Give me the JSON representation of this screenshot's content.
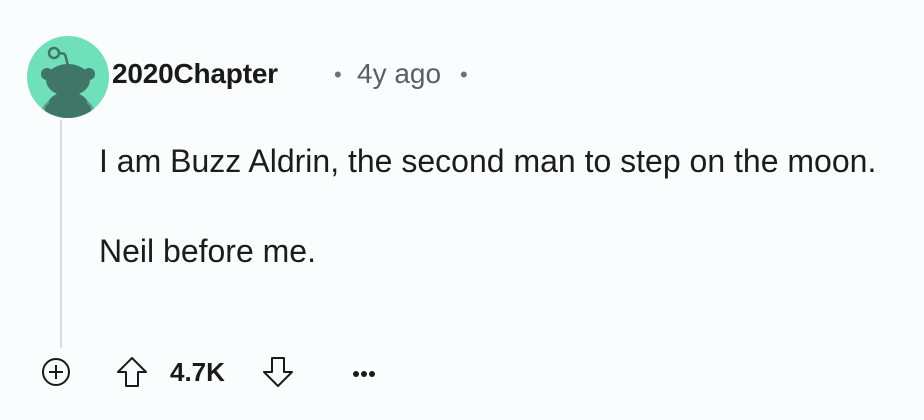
{
  "comment": {
    "author": "2020Chapter",
    "timestamp": "4y ago",
    "separator": "•",
    "body": [
      "I am Buzz Aldrin, the second man to step on the moon.",
      "Neil before me."
    ]
  },
  "actions": {
    "score": "4.7K",
    "expand_icon": "plus-circle-icon",
    "upvote_icon": "arrow-up-icon",
    "downvote_icon": "arrow-down-icon",
    "more_icon": "ellipsis-icon"
  },
  "colors": {
    "background": "#fbfcfd",
    "avatar_bg": "#6fe0b9",
    "avatar_figure": "#3f7668",
    "thread_line": "#d7dde0",
    "meta_text": "#576066"
  }
}
